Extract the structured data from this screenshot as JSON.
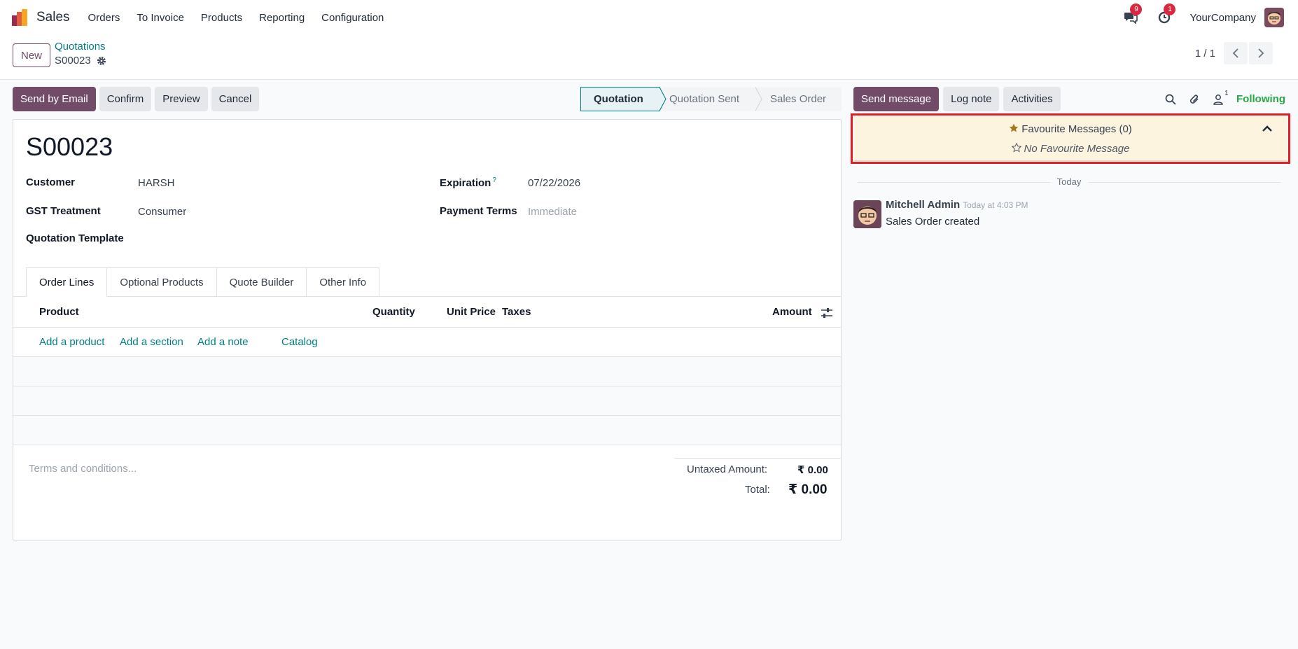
{
  "app": {
    "name": "Sales"
  },
  "menu": [
    "Orders",
    "To Invoice",
    "Products",
    "Reporting",
    "Configuration"
  ],
  "systray": {
    "messages_count": "9",
    "activities_count": "1",
    "company": "YourCompany"
  },
  "controlpanel": {
    "new_label": "New",
    "breadcrumb_parent": "Quotations",
    "breadcrumb_current": "S00023",
    "pager_value": "1 / 1"
  },
  "actions": {
    "send_email": "Send by Email",
    "confirm": "Confirm",
    "preview": "Preview",
    "cancel": "Cancel"
  },
  "statusbar": {
    "stages": [
      "Quotation",
      "Quotation Sent",
      "Sales Order"
    ],
    "active": "Quotation"
  },
  "record": {
    "name": "S00023",
    "customer_label": "Customer",
    "customer_value": "HARSH",
    "gst_label": "GST Treatment",
    "gst_value": "Consumer",
    "template_label": "Quotation Template",
    "expiration_label": "Expiration",
    "expiration_help": "?",
    "expiration_value": "07/22/2026",
    "payment_terms_label": "Payment Terms",
    "payment_terms_value": "Immediate"
  },
  "tabs": [
    "Order Lines",
    "Optional Products",
    "Quote Builder",
    "Other Info"
  ],
  "order_lines": {
    "headers": {
      "product": "Product",
      "quantity": "Quantity",
      "unit_price": "Unit Price",
      "taxes": "Taxes",
      "amount": "Amount"
    },
    "add_product": "Add a product",
    "add_section": "Add a section",
    "add_note": "Add a note",
    "catalog": "Catalog"
  },
  "footer": {
    "terms_placeholder": "Terms and conditions...",
    "untaxed_label": "Untaxed Amount:",
    "untaxed_value": "₹ 0.00",
    "total_label": "Total:",
    "total_value": "₹ 0.00"
  },
  "chatter": {
    "send_message": "Send message",
    "log_note": "Log note",
    "activities": "Activities",
    "followers_count": "1",
    "following": "Following",
    "fav_title": "Favourite Messages (0)",
    "fav_empty": "No Favourite Message",
    "date_separator": "Today",
    "message": {
      "author": "Mitchell Admin",
      "time": "Today at 4:03 PM",
      "body": "Sales Order created"
    }
  },
  "colors": {
    "primary": "#714b67",
    "link": "#017e84",
    "following": "#28a745",
    "highlight": "#e11d26",
    "fav_bg": "#fcf4df"
  }
}
